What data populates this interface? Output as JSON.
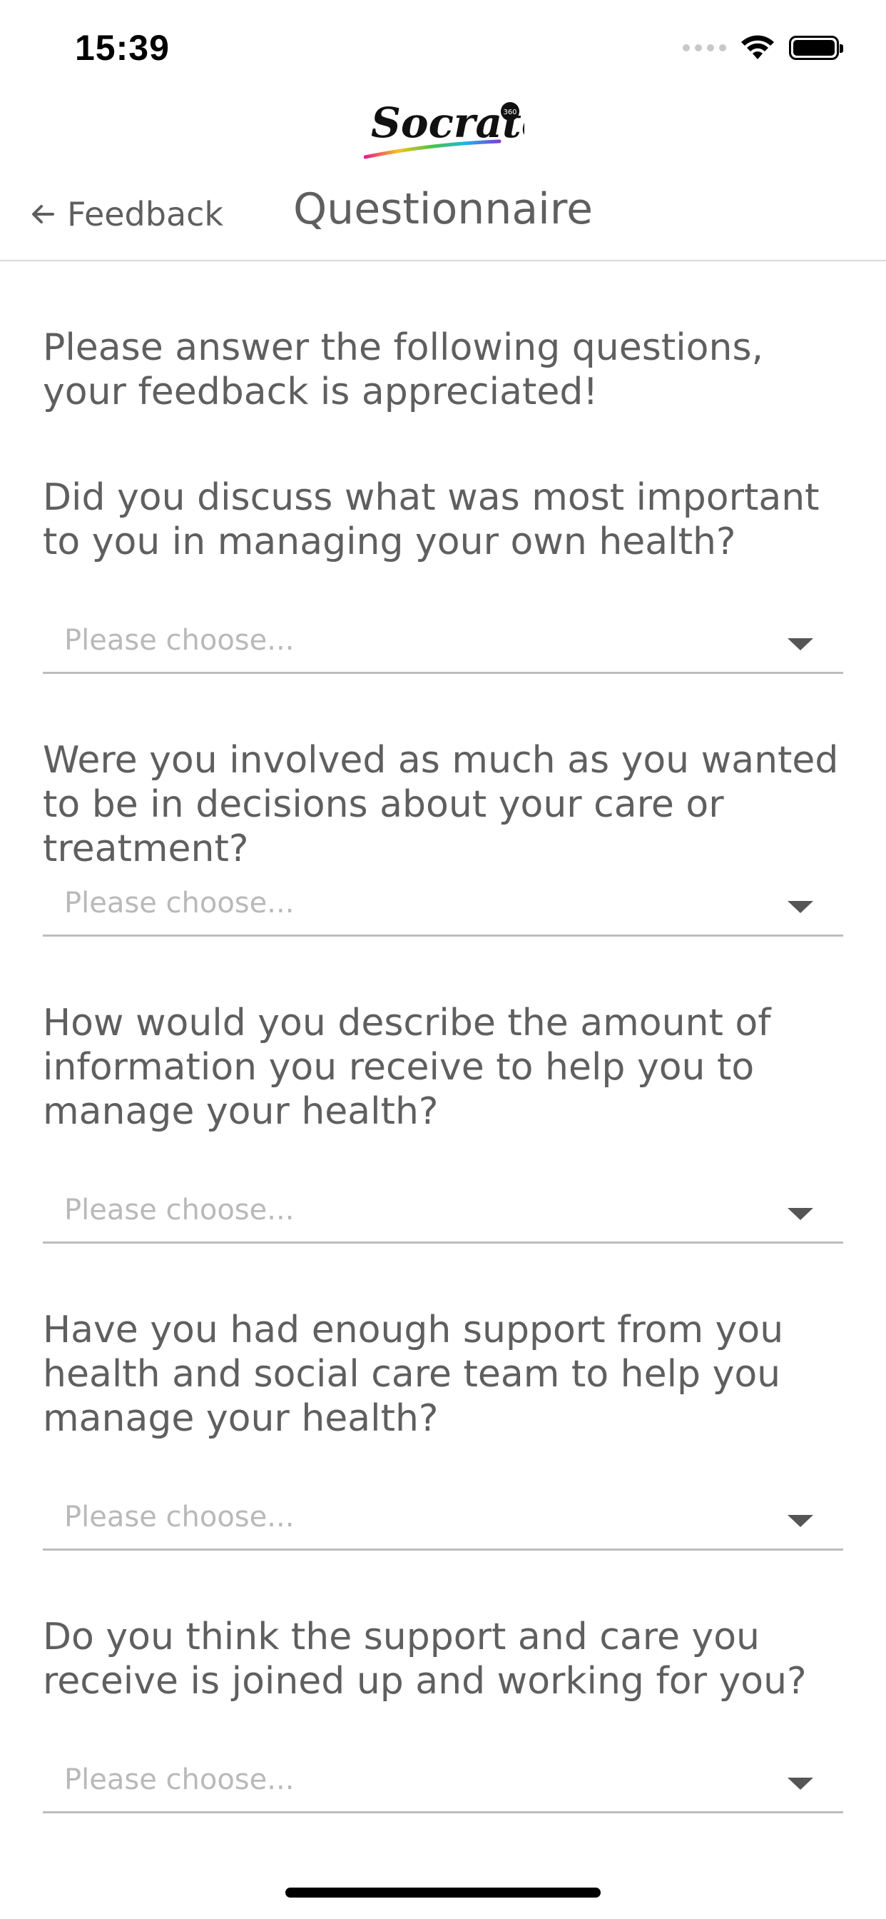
{
  "status_bar": {
    "time": "15:39",
    "icons": [
      "cellular-signal-icon",
      "wifi-icon",
      "battery-icon"
    ]
  },
  "logo": {
    "text": "Socrates",
    "badge": "360",
    "icon": "socrates-logo-icon"
  },
  "nav": {
    "back_label": "Feedback",
    "back_icon": "arrow-left-icon",
    "title": "Questionnaire"
  },
  "intro": "Please answer the following questions, your feedback is appreciated!",
  "questions": [
    {
      "text": "Did you discuss what was most important to you in managing your own health?",
      "placeholder": "Please choose..."
    },
    {
      "text": "Were you involved as much as you wanted to be in decisions about your care or treatment?",
      "placeholder": "Please choose..."
    },
    {
      "text": "How would you describe the amount of information you receive to help you to manage your health?",
      "placeholder": "Please choose..."
    },
    {
      "text": "Have you had enough support from you health and social care team to help you manage your health?",
      "placeholder": "Please choose..."
    },
    {
      "text": "Do you think the support and care you receive is joined up and working for you?",
      "placeholder": "Please choose..."
    }
  ],
  "colors": {
    "text": "#5f5f5f",
    "placeholder": "#b9b9b9",
    "divider": "#d9d9d9",
    "underline": "#bdbdbd"
  }
}
